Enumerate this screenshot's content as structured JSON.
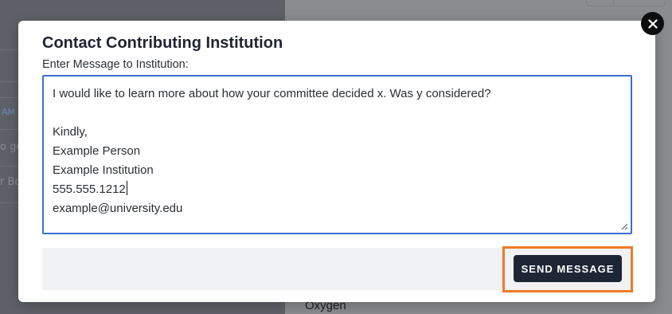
{
  "background": {
    "left_rows": [
      {
        "text": "AM"
      },
      {
        "text": "o ge"
      },
      {
        "text": "r Bo"
      }
    ],
    "right_list_item": "Oxygen"
  },
  "modal": {
    "title": "Contact Contributing Institution",
    "message_label": "Enter Message to Institution:",
    "message_lines": [
      "I would like to learn more about how your committee decided x. Was y considered?",
      "",
      "Kindly,",
      "Example Person",
      "Example Institution",
      "555.555.1212",
      "example@university.edu"
    ],
    "send_label": "SEND MESSAGE",
    "close_icon": "close-icon"
  },
  "colors": {
    "accent_highlight": "#f07a28",
    "button_bg": "#1e2535",
    "input_focus_border": "#3b6fd1"
  }
}
